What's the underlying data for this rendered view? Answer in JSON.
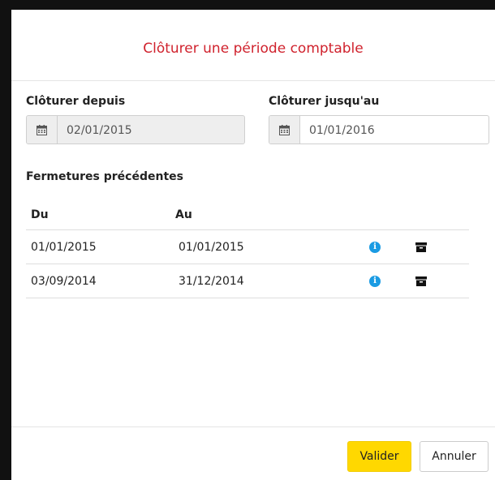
{
  "modal": {
    "title": "Clôturer une période comptable",
    "title_color": "#d0222d"
  },
  "form": {
    "from": {
      "label": "Clôturer depuis",
      "value": "02/01/2015",
      "disabled": true,
      "icon": "calendar-icon"
    },
    "to": {
      "label": "Clôturer jusqu'au",
      "value": "01/01/2016",
      "disabled": false,
      "icon": "calendar-icon"
    }
  },
  "previous_closures": {
    "title": "Fermetures précédentes",
    "columns": [
      "Du",
      "Au"
    ],
    "rows": [
      {
        "du": "01/01/2015",
        "au": "01/01/2015",
        "icons": [
          "info-icon",
          "archive-icon"
        ]
      },
      {
        "du": "03/09/2014",
        "au": "31/12/2014",
        "icons": [
          "info-icon",
          "archive-icon"
        ]
      }
    ]
  },
  "footer": {
    "validate_label": "Valider",
    "cancel_label": "Annuler",
    "accent_color": "#ffd800"
  }
}
